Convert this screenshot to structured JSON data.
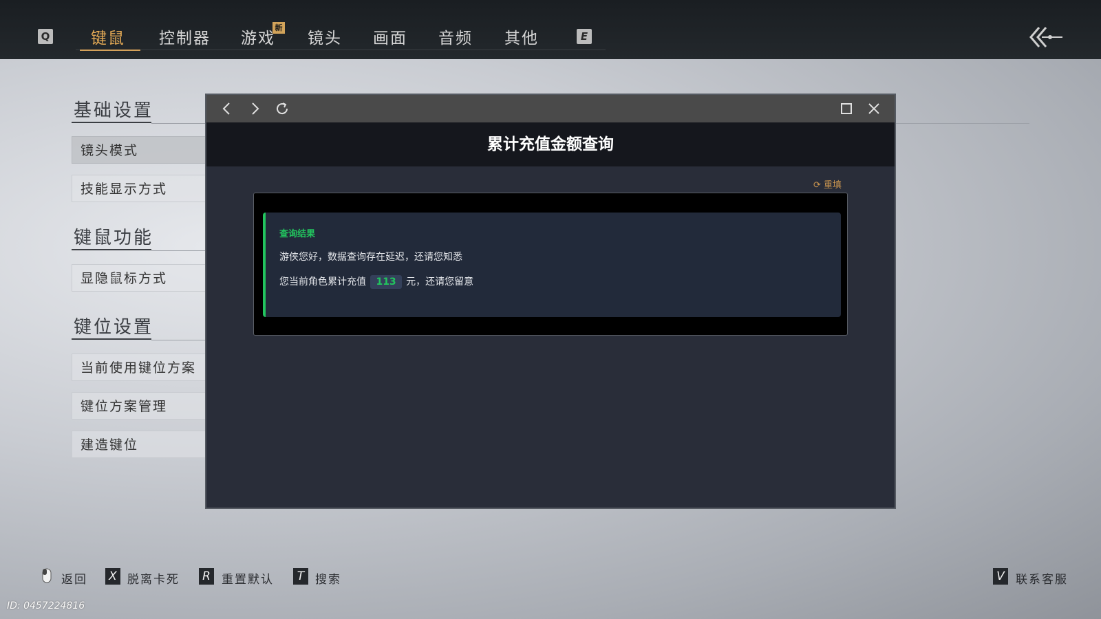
{
  "topbar": {
    "left_key": "Q",
    "right_key": "E",
    "tabs": [
      {
        "label": "键鼠"
      },
      {
        "label": "控制器"
      },
      {
        "label": "游戏"
      },
      {
        "label": "镜头"
      },
      {
        "label": "画面"
      },
      {
        "label": "音频"
      },
      {
        "label": "其他"
      }
    ],
    "new_badge": "新"
  },
  "sidebar": {
    "sections": [
      {
        "title": "基础设置",
        "items": [
          "镜头模式",
          "技能显示方式"
        ]
      },
      {
        "title": "键鼠功能",
        "items": [
          "显隐鼠标方式"
        ]
      },
      {
        "title": "键位设置",
        "items": [
          "当前使用键位方案",
          "键位方案管理",
          "建造键位"
        ]
      }
    ]
  },
  "dialog": {
    "title": "累计充值金额查询",
    "reset_label": "重填",
    "result_title": "查询结果",
    "line1": "游侠您好，数据查询存在延迟，还请您知悉",
    "line2_prefix": "您当前角色累计充值",
    "amount": "113",
    "line2_suffix": "元，还请您留意"
  },
  "footer": {
    "back_label": "返回",
    "unstuck_key": "X",
    "unstuck_label": "脱离卡死",
    "reset_key": "R",
    "reset_label": "重置默认",
    "search_key": "T",
    "search_label": "搜索",
    "support_key": "V",
    "support_label": "联系客服",
    "id_text": "ID: 0457224816"
  },
  "colors": {
    "accent": "#e3a955",
    "success": "#22c55e",
    "dialog_bg": "#292d39"
  }
}
